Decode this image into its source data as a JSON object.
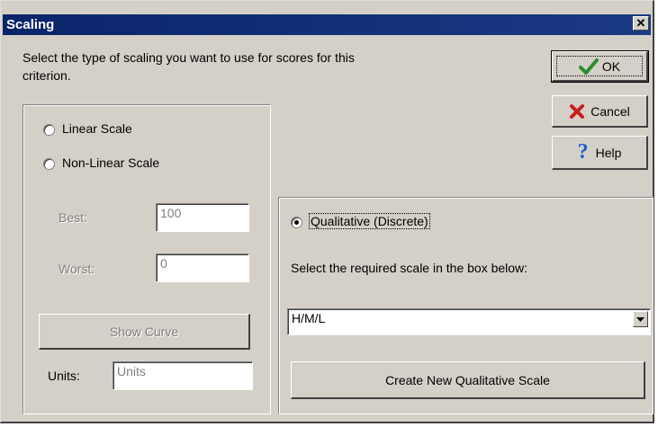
{
  "dialog": {
    "title": "Scaling",
    "close_glyph": "✕",
    "instruction": "Select the type of scaling you want to use for scores for this criterion."
  },
  "buttons": {
    "ok": "OK",
    "cancel": "Cancel",
    "help": "Help",
    "show_curve": "Show Curve",
    "create_scale": "Create New Qualitative Scale"
  },
  "left_group": {
    "linear_label": "Linear Scale",
    "nonlinear_label": "Non-Linear Scale",
    "best_label": "Best:",
    "best_value": "100",
    "worst_label": "Worst:",
    "worst_value": "0",
    "units_label": "Units:",
    "units_value": "Units"
  },
  "right_group": {
    "qualitative_label": "Qualitative (Discrete)",
    "prompt": "Select the required scale in the box below:",
    "selected_scale": "H/M/L"
  },
  "icons": {
    "ok": "check-icon",
    "cancel": "x-icon",
    "help": "question-icon"
  },
  "colors": {
    "title_bar": "#0a246a",
    "ok_check": "#2e8b2e",
    "cancel_x": "#c81e1e",
    "help_q": "#1c5bd6"
  }
}
